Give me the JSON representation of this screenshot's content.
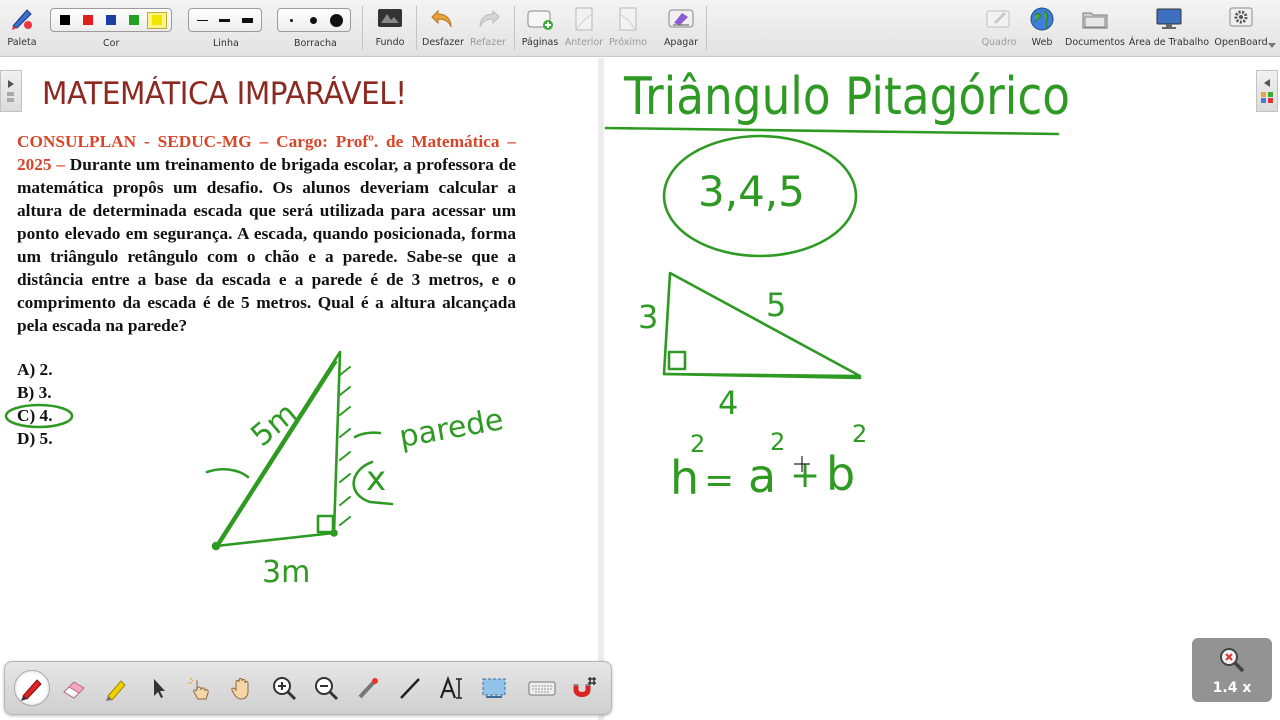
{
  "toolbar": {
    "palette_label": "Paleta",
    "color_label": "Cor",
    "line_label": "Linha",
    "eraser_label": "Borracha",
    "background_label": "Fundo",
    "undo_label": "Desfazer",
    "redo_label": "Refazer",
    "pages_label": "Páginas",
    "previous_label": "Anterior",
    "next_label": "Próximo",
    "erase_label": "Apagar",
    "board_label": "Quadro",
    "web_label": "Web",
    "documents_label": "Documentos",
    "desktop_label": "Área de Trabalho",
    "openboard_label": "OpenBoard",
    "colors": [
      "#000000",
      "#e01e1e",
      "#1c3fa6",
      "#22a31f",
      "#f2e600"
    ],
    "selected_color": "#22a31f"
  },
  "doc": {
    "title": "MATEMÁTICA IMPARÁVEL!",
    "question_source": "CONSULPLAN - SEDUC-MG – Cargo: Profº. de Matemática – 2025 –",
    "question_text": " Durante um treinamento de brigada escolar, a professora de matemática propôs um desafio. Os alunos deveriam calcular a altura de determinada escada que será utilizada para acessar um ponto elevado em segurança. A escada, quando posicionada, forma um triângulo retângulo com o chão e a parede. Sabe-se que a distância entre a base da escada e a parede é de 3 metros, e o comprimento da escada é de 5 metros. Qual é a altura alcançada pela escada na parede?",
    "options": [
      "A) 2.",
      "B) 3.",
      "C) 4.",
      "D) 5."
    ],
    "selected_option": "C) 4."
  },
  "annotations": {
    "ladder_length": "5m",
    "base_length": "3m",
    "wall_label": "parede",
    "unknown_label": "x",
    "heading": "Triângulo Pitagórico",
    "triple": "3,4,5",
    "side_a": "3",
    "side_b": "4",
    "hypotenuse": "5",
    "formula_h": "h",
    "formula_eq": "=",
    "formula_a": "a",
    "formula_plus": "+",
    "formula_b": "b",
    "formula_exp": "2",
    "ink_color": "#2e9a23"
  },
  "zoom": {
    "label": "1.4 x"
  }
}
